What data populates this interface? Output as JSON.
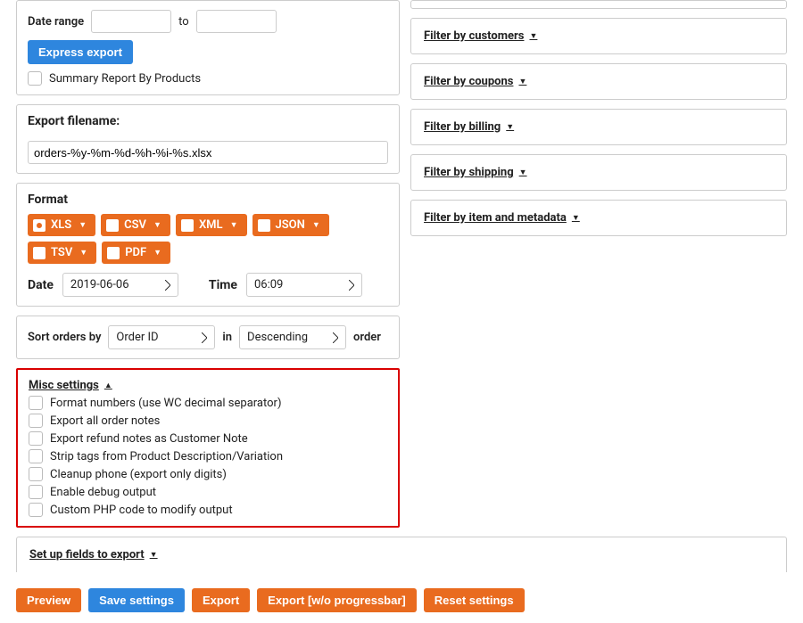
{
  "dateRange": {
    "label": "Date range",
    "from": "",
    "to": "",
    "toLabel": "to"
  },
  "expressExport": "Express export",
  "summaryReport": {
    "label": "Summary Report By Products"
  },
  "filename": {
    "label": "Export filename:",
    "value": "orders-%y-%m-%d-%h-%i-%s.xlsx"
  },
  "format": {
    "label": "Format",
    "options": [
      "XLS",
      "CSV",
      "XML",
      "JSON",
      "TSV",
      "PDF"
    ],
    "selected": "XLS"
  },
  "dateTime": {
    "dateLabel": "Date",
    "date": "2019-06-06",
    "timeLabel": "Time",
    "time": "06:09"
  },
  "sort": {
    "label": "Sort orders by",
    "field": "Order ID",
    "inLabel": "in",
    "direction": "Descending",
    "orderLabel": "order"
  },
  "misc": {
    "title": "Misc settings",
    "items": [
      "Format numbers (use WC decimal separator)",
      "Export all order notes",
      "Export refund notes as Customer Note",
      "Strip tags from Product Description/Variation",
      "Cleanup phone (export only digits)",
      "Enable debug output",
      "Custom PHP code to modify output"
    ]
  },
  "setupFields": "Set up fields to export",
  "filters": {
    "customers": "Filter by customers",
    "coupons": "Filter by coupons",
    "billing": "Filter by billing",
    "shipping": "Filter by shipping",
    "item": "Filter by item and metadata"
  },
  "footer": {
    "preview": "Preview",
    "save": "Save settings",
    "export": "Export",
    "exportNoBar": "Export [w/o progressbar]",
    "reset": "Reset settings"
  }
}
